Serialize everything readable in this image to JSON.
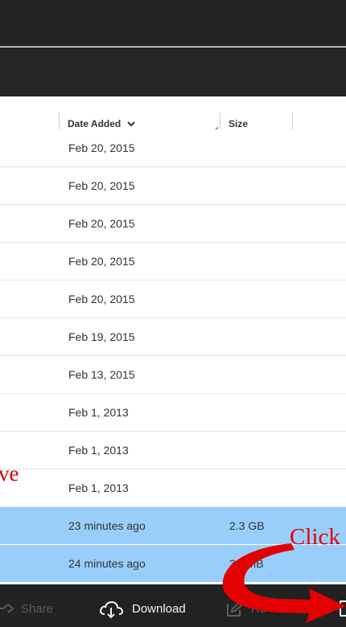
{
  "table": {
    "columns": {
      "date_added": "Date Added",
      "size": "Size"
    },
    "rows": [
      {
        "date": "Feb 20, 2015",
        "size": ""
      },
      {
        "date": "Feb 20, 2015",
        "size": ""
      },
      {
        "date": "Feb 20, 2015",
        "size": ""
      },
      {
        "date": "Feb 20, 2015",
        "size": ""
      },
      {
        "date": "Feb 20, 2015",
        "size": ""
      },
      {
        "date": "Feb 19, 2015",
        "size": ""
      },
      {
        "date": "Feb 13, 2015",
        "size": ""
      },
      {
        "date": "Feb 1, 2013",
        "size": ""
      },
      {
        "date": "Feb 1, 2013",
        "size": ""
      },
      {
        "date": "Feb 1, 2013",
        "size": ""
      },
      {
        "date": "23 minutes ago",
        "size": "2.3 GB",
        "selected": true
      },
      {
        "date": "24 minutes ago",
        "size": "39",
        "selected": true,
        "size_suffix": "MB"
      }
    ]
  },
  "toolbar": {
    "share_label": "Share",
    "download_label": "Download",
    "rename_label": "Re"
  },
  "annotations": {
    "left_text": "ve",
    "right_text": "Click t"
  },
  "colors": {
    "selected_row": "#99cefa",
    "annotation_red": "#e30000",
    "toolbar_bg": "#222222"
  },
  "icons": {
    "sort": "chevron-down-icon",
    "share": "share-icon",
    "download": "cloud-download-icon",
    "rename": "pencil-icon",
    "more": "square-icon"
  }
}
